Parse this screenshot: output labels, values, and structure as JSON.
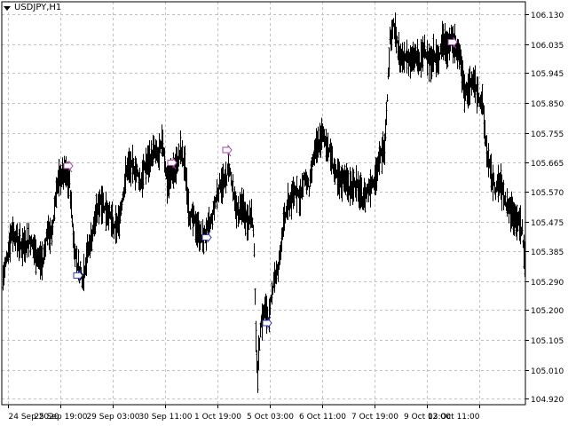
{
  "window": {
    "symbol_title": "USDJPY,H1"
  },
  "chart_data": {
    "type": "bar",
    "series_type": "ohlc",
    "title": "USDJPY,H1",
    "symbol": "USDJPY",
    "timeframe": "H1",
    "xlabel": "",
    "ylabel": "",
    "ylim": [
      104.9,
      106.17
    ],
    "grid": true,
    "grid_style": "dotted",
    "y_ticks": [
      "106.130",
      "106.035",
      "105.945",
      "105.850",
      "105.755",
      "105.665",
      "105.570",
      "105.475",
      "105.385",
      "105.290",
      "105.200",
      "105.105",
      "105.010",
      "104.920"
    ],
    "x_ticks": [
      "24 Sep 2020",
      "25 Sep 19:00",
      "29 Sep 03:00",
      "30 Sep 11:00",
      "1 Oct 19:00",
      "5 Oct 03:00",
      "6 Oct 11:00",
      "7 Oct 19:00",
      "9 Oct 03:00",
      "12 Oct 11:00"
    ],
    "colors": {
      "bars": "#000000",
      "grid": "#c0c0c0",
      "sell_arrow": "#aa44aa",
      "buy_arrow": "#3333aa",
      "axis_text": "#000000"
    },
    "price_points": [
      [
        0,
        105.3
      ],
      [
        10,
        105.45
      ],
      [
        20,
        105.4
      ],
      [
        30,
        105.42
      ],
      [
        40,
        105.36
      ],
      [
        45,
        105.35
      ],
      [
        50,
        105.45
      ],
      [
        55,
        105.43
      ],
      [
        60,
        105.58
      ],
      [
        65,
        105.62
      ],
      [
        70,
        105.63
      ],
      [
        75,
        105.6
      ],
      [
        80,
        105.4
      ],
      [
        85,
        105.33
      ],
      [
        90,
        105.3
      ],
      [
        95,
        105.38
      ],
      [
        100,
        105.43
      ],
      [
        105,
        105.5
      ],
      [
        110,
        105.55
      ],
      [
        115,
        105.52
      ],
      [
        120,
        105.5
      ],
      [
        125,
        105.45
      ],
      [
        130,
        105.47
      ],
      [
        140,
        105.65
      ],
      [
        150,
        105.64
      ],
      [
        155,
        105.6
      ],
      [
        160,
        105.65
      ],
      [
        165,
        105.67
      ],
      [
        170,
        105.7
      ],
      [
        175,
        105.68
      ],
      [
        180,
        105.73
      ],
      [
        185,
        105.6
      ],
      [
        190,
        105.63
      ],
      [
        195,
        105.65
      ],
      [
        200,
        105.7
      ],
      [
        205,
        105.65
      ],
      [
        210,
        105.5
      ],
      [
        215,
        105.48
      ],
      [
        220,
        105.45
      ],
      [
        225,
        105.42
      ],
      [
        230,
        105.45
      ],
      [
        235,
        105.48
      ],
      [
        240,
        105.55
      ],
      [
        245,
        105.6
      ],
      [
        250,
        105.6
      ],
      [
        255,
        105.65
      ],
      [
        260,
        105.55
      ],
      [
        265,
        105.5
      ],
      [
        270,
        105.53
      ],
      [
        275,
        105.48
      ],
      [
        280,
        105.5
      ],
      [
        283,
        105.4
      ],
      [
        285,
        105.1
      ],
      [
        287,
        105.0
      ],
      [
        290,
        105.15
      ],
      [
        295,
        105.2
      ],
      [
        300,
        105.17
      ],
      [
        305,
        105.3
      ],
      [
        310,
        105.32
      ],
      [
        315,
        105.45
      ],
      [
        320,
        105.52
      ],
      [
        325,
        105.55
      ],
      [
        330,
        105.58
      ],
      [
        335,
        105.55
      ],
      [
        340,
        105.62
      ],
      [
        345,
        105.58
      ],
      [
        350,
        105.68
      ],
      [
        355,
        105.72
      ],
      [
        360,
        105.75
      ],
      [
        365,
        105.72
      ],
      [
        370,
        105.68
      ],
      [
        375,
        105.62
      ],
      [
        380,
        105.6
      ],
      [
        385,
        105.62
      ],
      [
        390,
        105.58
      ],
      [
        395,
        105.6
      ],
      [
        400,
        105.58
      ],
      [
        405,
        105.55
      ],
      [
        410,
        105.57
      ],
      [
        415,
        105.6
      ],
      [
        420,
        105.62
      ],
      [
        425,
        105.68
      ],
      [
        430,
        105.72
      ],
      [
        433,
        105.88
      ],
      [
        436,
        106.05
      ],
      [
        440,
        106.1
      ],
      [
        445,
        106.02
      ],
      [
        450,
        105.98
      ],
      [
        455,
        106.0
      ],
      [
        460,
        105.98
      ],
      [
        465,
        106.0
      ],
      [
        470,
        105.97
      ],
      [
        475,
        106.03
      ],
      [
        480,
        105.98
      ],
      [
        485,
        106.0
      ],
      [
        490,
        105.98
      ],
      [
        495,
        106.05
      ],
      [
        500,
        106.03
      ],
      [
        505,
        106.05
      ],
      [
        510,
        106.03
      ],
      [
        515,
        106.0
      ],
      [
        520,
        105.88
      ],
      [
        525,
        105.9
      ],
      [
        530,
        105.92
      ],
      [
        535,
        105.88
      ],
      [
        540,
        105.85
      ],
      [
        545,
        105.7
      ],
      [
        550,
        105.62
      ],
      [
        555,
        105.58
      ],
      [
        560,
        105.6
      ],
      [
        565,
        105.55
      ],
      [
        570,
        105.52
      ],
      [
        575,
        105.5
      ],
      [
        580,
        105.48
      ],
      [
        585,
        105.45
      ],
      [
        588,
        105.35
      ],
      [
        591,
        105.26
      ]
    ],
    "arrows": [
      {
        "type": "sell",
        "xi": 75,
        "price": 105.65
      },
      {
        "type": "buy",
        "xi": 86,
        "price": 105.31
      },
      {
        "type": "sell",
        "xi": 192,
        "price": 105.66
      },
      {
        "type": "buy",
        "xi": 231,
        "price": 105.43
      },
      {
        "type": "sell",
        "xi": 254,
        "price": 105.7
      },
      {
        "type": "buy",
        "xi": 299,
        "price": 105.16
      },
      {
        "type": "sell",
        "xi": 508,
        "price": 106.04
      }
    ]
  }
}
